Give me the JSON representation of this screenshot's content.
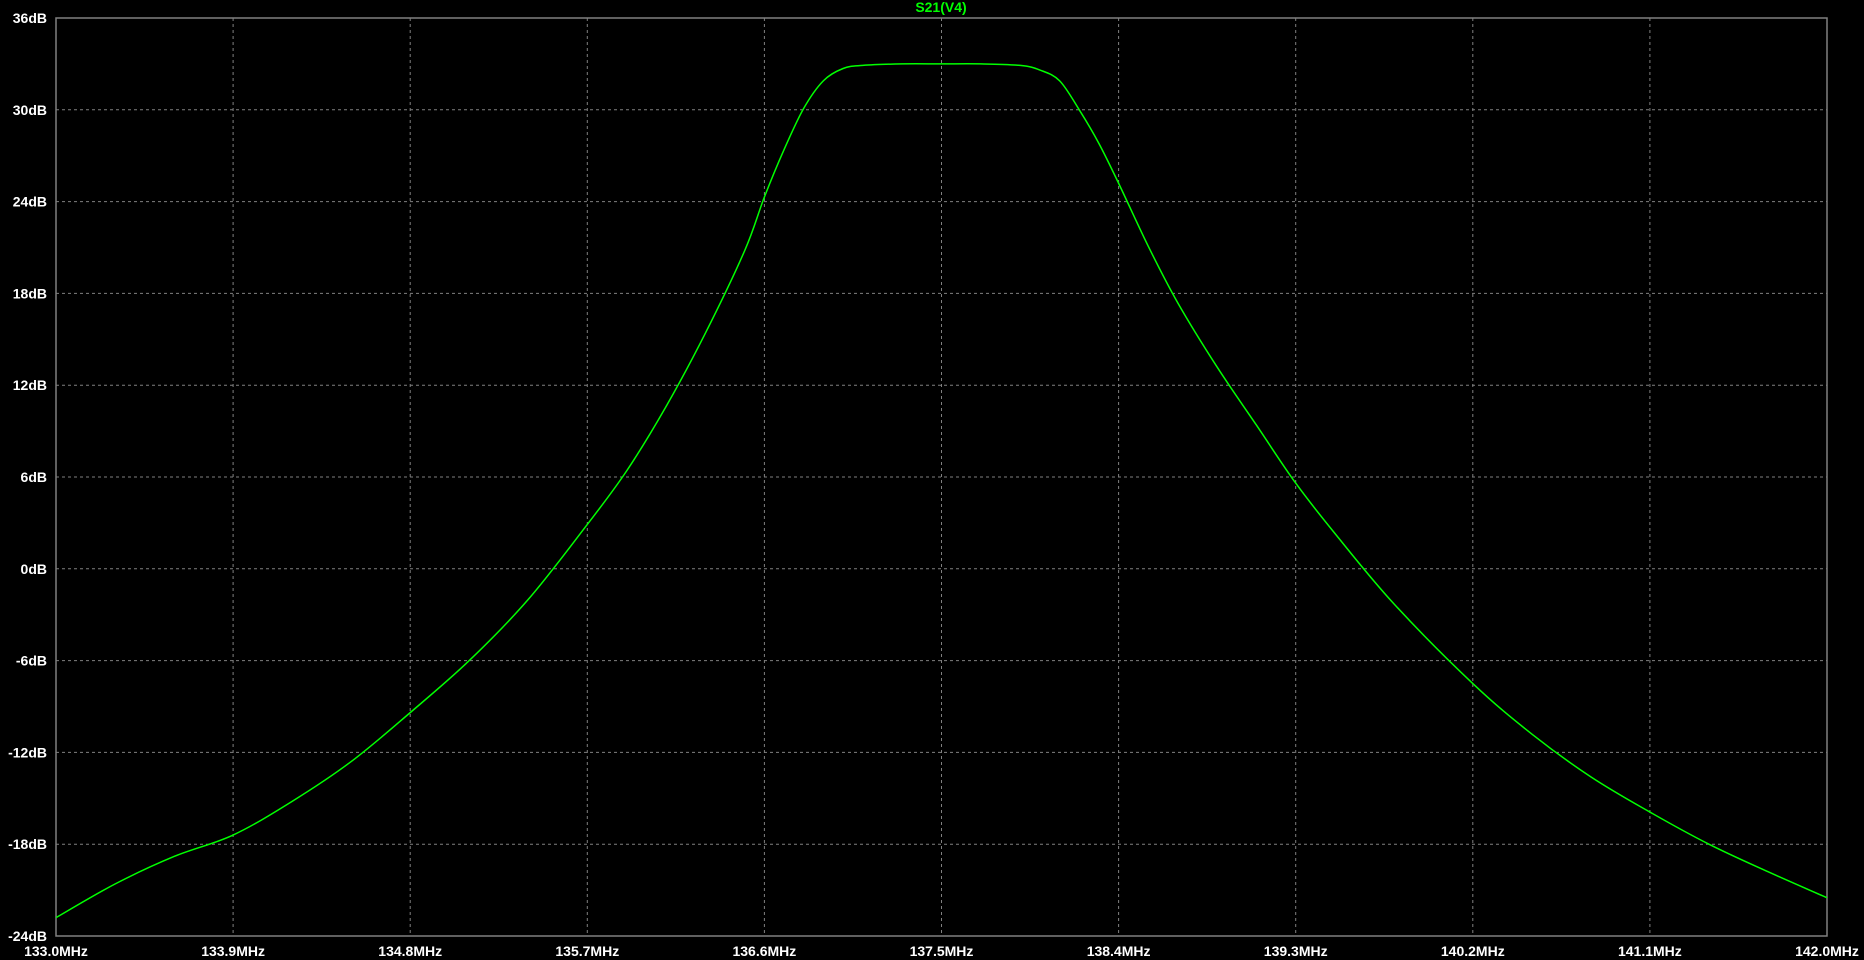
{
  "chart_data": {
    "type": "line",
    "title": "S21(V4)",
    "xlabel": "",
    "ylabel": "",
    "x_unit": "MHz",
    "y_unit": "dB",
    "xlim": [
      133.0,
      142.0
    ],
    "ylim": [
      -24,
      36
    ],
    "x_ticks": [
      133.0,
      133.9,
      134.8,
      135.7,
      136.6,
      137.5,
      138.4,
      139.3,
      140.2,
      141.1,
      142.0
    ],
    "x_tick_labels": [
      "133.0MHz",
      "133.9MHz",
      "134.8MHz",
      "135.7MHz",
      "136.6MHz",
      "137.5MHz",
      "138.4MHz",
      "139.3MHz",
      "140.2MHz",
      "141.1MHz",
      "142.0MHz"
    ],
    "y_ticks": [
      -24,
      -18,
      -12,
      -6,
      0,
      6,
      12,
      18,
      24,
      30,
      36
    ],
    "y_tick_labels": [
      "-24dB",
      "-18dB",
      "-12dB",
      "-6dB",
      "0dB",
      "6dB",
      "12dB",
      "18dB",
      "24dB",
      "30dB",
      "36dB"
    ],
    "grid": true,
    "background_color": "#000000",
    "grid_color": "#808080",
    "axis_color": "#808080",
    "tick_label_color": "#ffffff",
    "series": [
      {
        "name": "S21(V4)",
        "color": "#00ff00",
        "x": [
          133.0,
          133.3,
          133.6,
          133.9,
          134.2,
          134.5,
          134.8,
          135.1,
          135.4,
          135.7,
          135.9,
          136.1,
          136.3,
          136.5,
          136.6,
          136.7,
          136.8,
          136.9,
          137.0,
          137.1,
          137.3,
          137.5,
          137.7,
          137.9,
          138.0,
          138.1,
          138.2,
          138.3,
          138.4,
          138.55,
          138.7,
          138.9,
          139.1,
          139.3,
          139.5,
          139.8,
          140.2,
          140.5,
          140.8,
          141.1,
          141.4,
          141.7,
          142.0
        ],
        "y": [
          -22.8,
          -20.6,
          -18.8,
          -17.4,
          -15.2,
          -12.6,
          -9.4,
          -6.0,
          -2.0,
          2.9,
          6.4,
          10.6,
          15.4,
          20.8,
          24.3,
          27.4,
          30.1,
          31.9,
          32.7,
          32.9,
          33.0,
          33.0,
          33.0,
          32.9,
          32.6,
          31.9,
          30.0,
          27.8,
          25.2,
          21.1,
          17.4,
          13.2,
          9.4,
          5.6,
          2.3,
          -2.3,
          -7.5,
          -10.8,
          -13.6,
          -15.9,
          -18.0,
          -19.8,
          -21.5
        ]
      }
    ]
  }
}
